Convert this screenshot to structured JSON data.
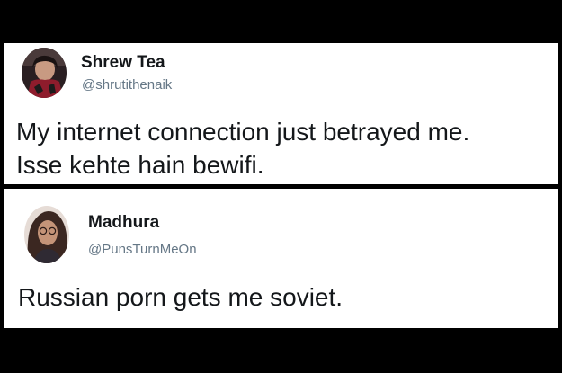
{
  "tweets": [
    {
      "display_name": "Shrew Tea",
      "handle": "@shrutithenaik",
      "text_lines": [
        "My internet connection just betrayed me.",
        "Isse kehte hain bewifi."
      ]
    },
    {
      "display_name": "Madhura",
      "handle": "@PunsTurnMeOn",
      "text_lines": [
        "Russian porn gets me soviet."
      ]
    }
  ],
  "colors": {
    "background": "#000000",
    "card": "#ffffff",
    "name_text": "#14171a",
    "handle_text": "#657786"
  }
}
